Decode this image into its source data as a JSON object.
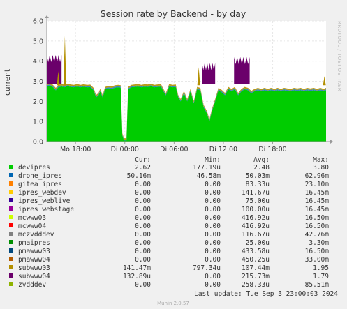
{
  "chart_data": {
    "type": "area",
    "title": "Session rate by Backend - by day",
    "ylabel": "current",
    "xlabel": "",
    "watermark": "RRDTOOL / TOBI OETIKER",
    "ylim": [
      0,
      6.0
    ],
    "yticks": [
      "0.0",
      "1.0",
      "2.0",
      "3.0",
      "4.0",
      "5.0",
      "6.0"
    ],
    "grid": true,
    "x_range": [
      "Mon 14:30",
      "Tue 23:00"
    ],
    "x_ticks": [
      {
        "label": "Mo 18:00",
        "hour": 18
      },
      {
        "label": "Di 00:00",
        "hour": 24
      },
      {
        "label": "Di 06:00",
        "hour": 30
      },
      {
        "label": "Di 12:00",
        "hour": 36
      },
      {
        "label": "Di 18:00",
        "hour": 42
      }
    ],
    "x_start_hour": 14.5,
    "x_end_hour": 48.5,
    "green_series": [
      [
        14.5,
        2.75
      ],
      [
        14.8,
        2.78
      ],
      [
        15.2,
        2.72
      ],
      [
        15.6,
        2.55
      ],
      [
        15.9,
        2.7
      ],
      [
        16.3,
        2.74
      ],
      [
        16.7,
        2.7
      ],
      [
        17.0,
        2.76
      ],
      [
        17.4,
        2.72
      ],
      [
        17.8,
        2.7
      ],
      [
        18.2,
        2.74
      ],
      [
        18.6,
        2.7
      ],
      [
        19.0,
        2.73
      ],
      [
        19.4,
        2.7
      ],
      [
        19.8,
        2.71
      ],
      [
        20.2,
        2.55
      ],
      [
        20.5,
        2.2
      ],
      [
        20.8,
        2.3
      ],
      [
        21.0,
        2.5
      ],
      [
        21.3,
        2.2
      ],
      [
        21.6,
        2.6
      ],
      [
        22.0,
        2.65
      ],
      [
        22.4,
        2.62
      ],
      [
        22.8,
        2.68
      ],
      [
        23.2,
        2.7
      ],
      [
        23.5,
        2.68
      ],
      [
        23.7,
        0.3
      ],
      [
        23.9,
        0.05
      ],
      [
        24.2,
        0.05
      ],
      [
        24.4,
        2.6
      ],
      [
        24.8,
        2.7
      ],
      [
        25.2,
        2.72
      ],
      [
        25.6,
        2.74
      ],
      [
        26.0,
        2.7
      ],
      [
        26.4,
        2.73
      ],
      [
        26.8,
        2.72
      ],
      [
        27.2,
        2.75
      ],
      [
        27.6,
        2.7
      ],
      [
        28.0,
        2.72
      ],
      [
        28.4,
        2.74
      ],
      [
        28.7,
        2.5
      ],
      [
        29.0,
        2.3
      ],
      [
        29.4,
        2.74
      ],
      [
        29.8,
        2.7
      ],
      [
        30.2,
        2.72
      ],
      [
        30.5,
        2.2
      ],
      [
        30.8,
        2.0
      ],
      [
        31.2,
        2.4
      ],
      [
        31.6,
        2.0
      ],
      [
        32.0,
        2.5
      ],
      [
        32.4,
        1.9
      ],
      [
        32.8,
        2.6
      ],
      [
        33.2,
        2.55
      ],
      [
        33.6,
        1.7
      ],
      [
        34.0,
        1.4
      ],
      [
        34.3,
        1.0
      ],
      [
        34.6,
        1.5
      ],
      [
        35.0,
        2.0
      ],
      [
        35.4,
        2.55
      ],
      [
        35.8,
        2.45
      ],
      [
        36.2,
        2.3
      ],
      [
        36.6,
        2.6
      ],
      [
        37.0,
        2.5
      ],
      [
        37.4,
        2.6
      ],
      [
        37.8,
        2.3
      ],
      [
        38.2,
        2.5
      ],
      [
        38.6,
        2.6
      ],
      [
        39.0,
        2.55
      ],
      [
        39.4,
        2.4
      ],
      [
        39.8,
        2.5
      ],
      [
        40.2,
        2.55
      ],
      [
        40.6,
        2.5
      ],
      [
        41.0,
        2.55
      ],
      [
        41.4,
        2.5
      ],
      [
        41.8,
        2.55
      ],
      [
        42.2,
        2.5
      ],
      [
        42.6,
        2.55
      ],
      [
        43.0,
        2.5
      ],
      [
        43.4,
        2.55
      ],
      [
        43.8,
        2.52
      ],
      [
        44.2,
        2.5
      ],
      [
        44.6,
        2.55
      ],
      [
        45.0,
        2.52
      ],
      [
        45.4,
        2.55
      ],
      [
        45.8,
        2.5
      ],
      [
        46.2,
        2.55
      ],
      [
        46.6,
        2.52
      ],
      [
        47.0,
        2.55
      ],
      [
        47.4,
        2.5
      ],
      [
        47.8,
        2.55
      ],
      [
        48.2,
        2.5
      ],
      [
        48.5,
        2.55
      ]
    ],
    "purple_spikes": [
      {
        "from": 14.5,
        "to": 16.3,
        "peak": 4.3
      },
      {
        "from": 33.4,
        "to": 35.0,
        "peak": 3.9
      },
      {
        "from": 37.3,
        "to": 39.2,
        "peak": 4.2
      }
    ],
    "orange_spikes": [
      {
        "hour": 16.7,
        "peak": 5.25
      },
      {
        "hour": 15.9,
        "peak": 3.5
      },
      {
        "hour": 33.0,
        "peak": 3.7
      },
      {
        "hour": 48.3,
        "peak": 3.25
      }
    ],
    "legend_headers": {
      "cur": "Cur:",
      "min": "Min:",
      "avg": "Avg:",
      "max": "Max:"
    },
    "series": [
      {
        "name": "devipres",
        "color": "#00cc00",
        "cur": "2.62",
        "min": "177.19u",
        "avg": "2.48",
        "max": "3.80"
      },
      {
        "name": "drone_ipres",
        "color": "#0066b3",
        "cur": "50.16m",
        "min": "46.58m",
        "avg": "50.03m",
        "max": "62.96m"
      },
      {
        "name": "gitea_ipres",
        "color": "#ff8000",
        "cur": "0.00",
        "min": "0.00",
        "avg": "83.33u",
        "max": "23.10m"
      },
      {
        "name": "ipres_webdev",
        "color": "#ffcc00",
        "cur": "0.00",
        "min": "0.00",
        "avg": "141.67u",
        "max": "16.45m"
      },
      {
        "name": "ipres_weblive",
        "color": "#330099",
        "cur": "0.00",
        "min": "0.00",
        "avg": "75.00u",
        "max": "16.45m"
      },
      {
        "name": "ipres_webstage",
        "color": "#990099",
        "cur": "0.00",
        "min": "0.00",
        "avg": "100.00u",
        "max": "16.45m"
      },
      {
        "name": "mcwww03",
        "color": "#ccff00",
        "cur": "0.00",
        "min": "0.00",
        "avg": "416.92u",
        "max": "16.50m"
      },
      {
        "name": "mcwww04",
        "color": "#ff0000",
        "cur": "0.00",
        "min": "0.00",
        "avg": "416.92u",
        "max": "16.50m"
      },
      {
        "name": "mczvdddev",
        "color": "#808080",
        "cur": "0.00",
        "min": "0.00",
        "avg": "116.67u",
        "max": "42.76m"
      },
      {
        "name": "pmaipres",
        "color": "#008f00",
        "cur": "0.00",
        "min": "0.00",
        "avg": "25.00u",
        "max": "3.30m"
      },
      {
        "name": "pmawww03",
        "color": "#00487d",
        "cur": "0.00",
        "min": "0.00",
        "avg": "433.58u",
        "max": "16.50m"
      },
      {
        "name": "pmawww04",
        "color": "#b35a00",
        "cur": "0.00",
        "min": "0.00",
        "avg": "450.25u",
        "max": "33.00m"
      },
      {
        "name": "subwww03",
        "color": "#b38f00",
        "cur": "141.47m",
        "min": "797.34u",
        "avg": "107.44m",
        "max": "1.95"
      },
      {
        "name": "subwww04",
        "color": "#6b006b",
        "cur": "132.89u",
        "min": "0.00",
        "avg": "215.73m",
        "max": "1.79"
      },
      {
        "name": "zvdddev",
        "color": "#8fb300",
        "cur": "0.00",
        "min": "0.00",
        "avg": "258.33u",
        "max": "85.51m"
      }
    ],
    "last_update": "Last update: Tue Sep  3 23:00:03 2024",
    "footer": "Munin 2.0.57"
  }
}
